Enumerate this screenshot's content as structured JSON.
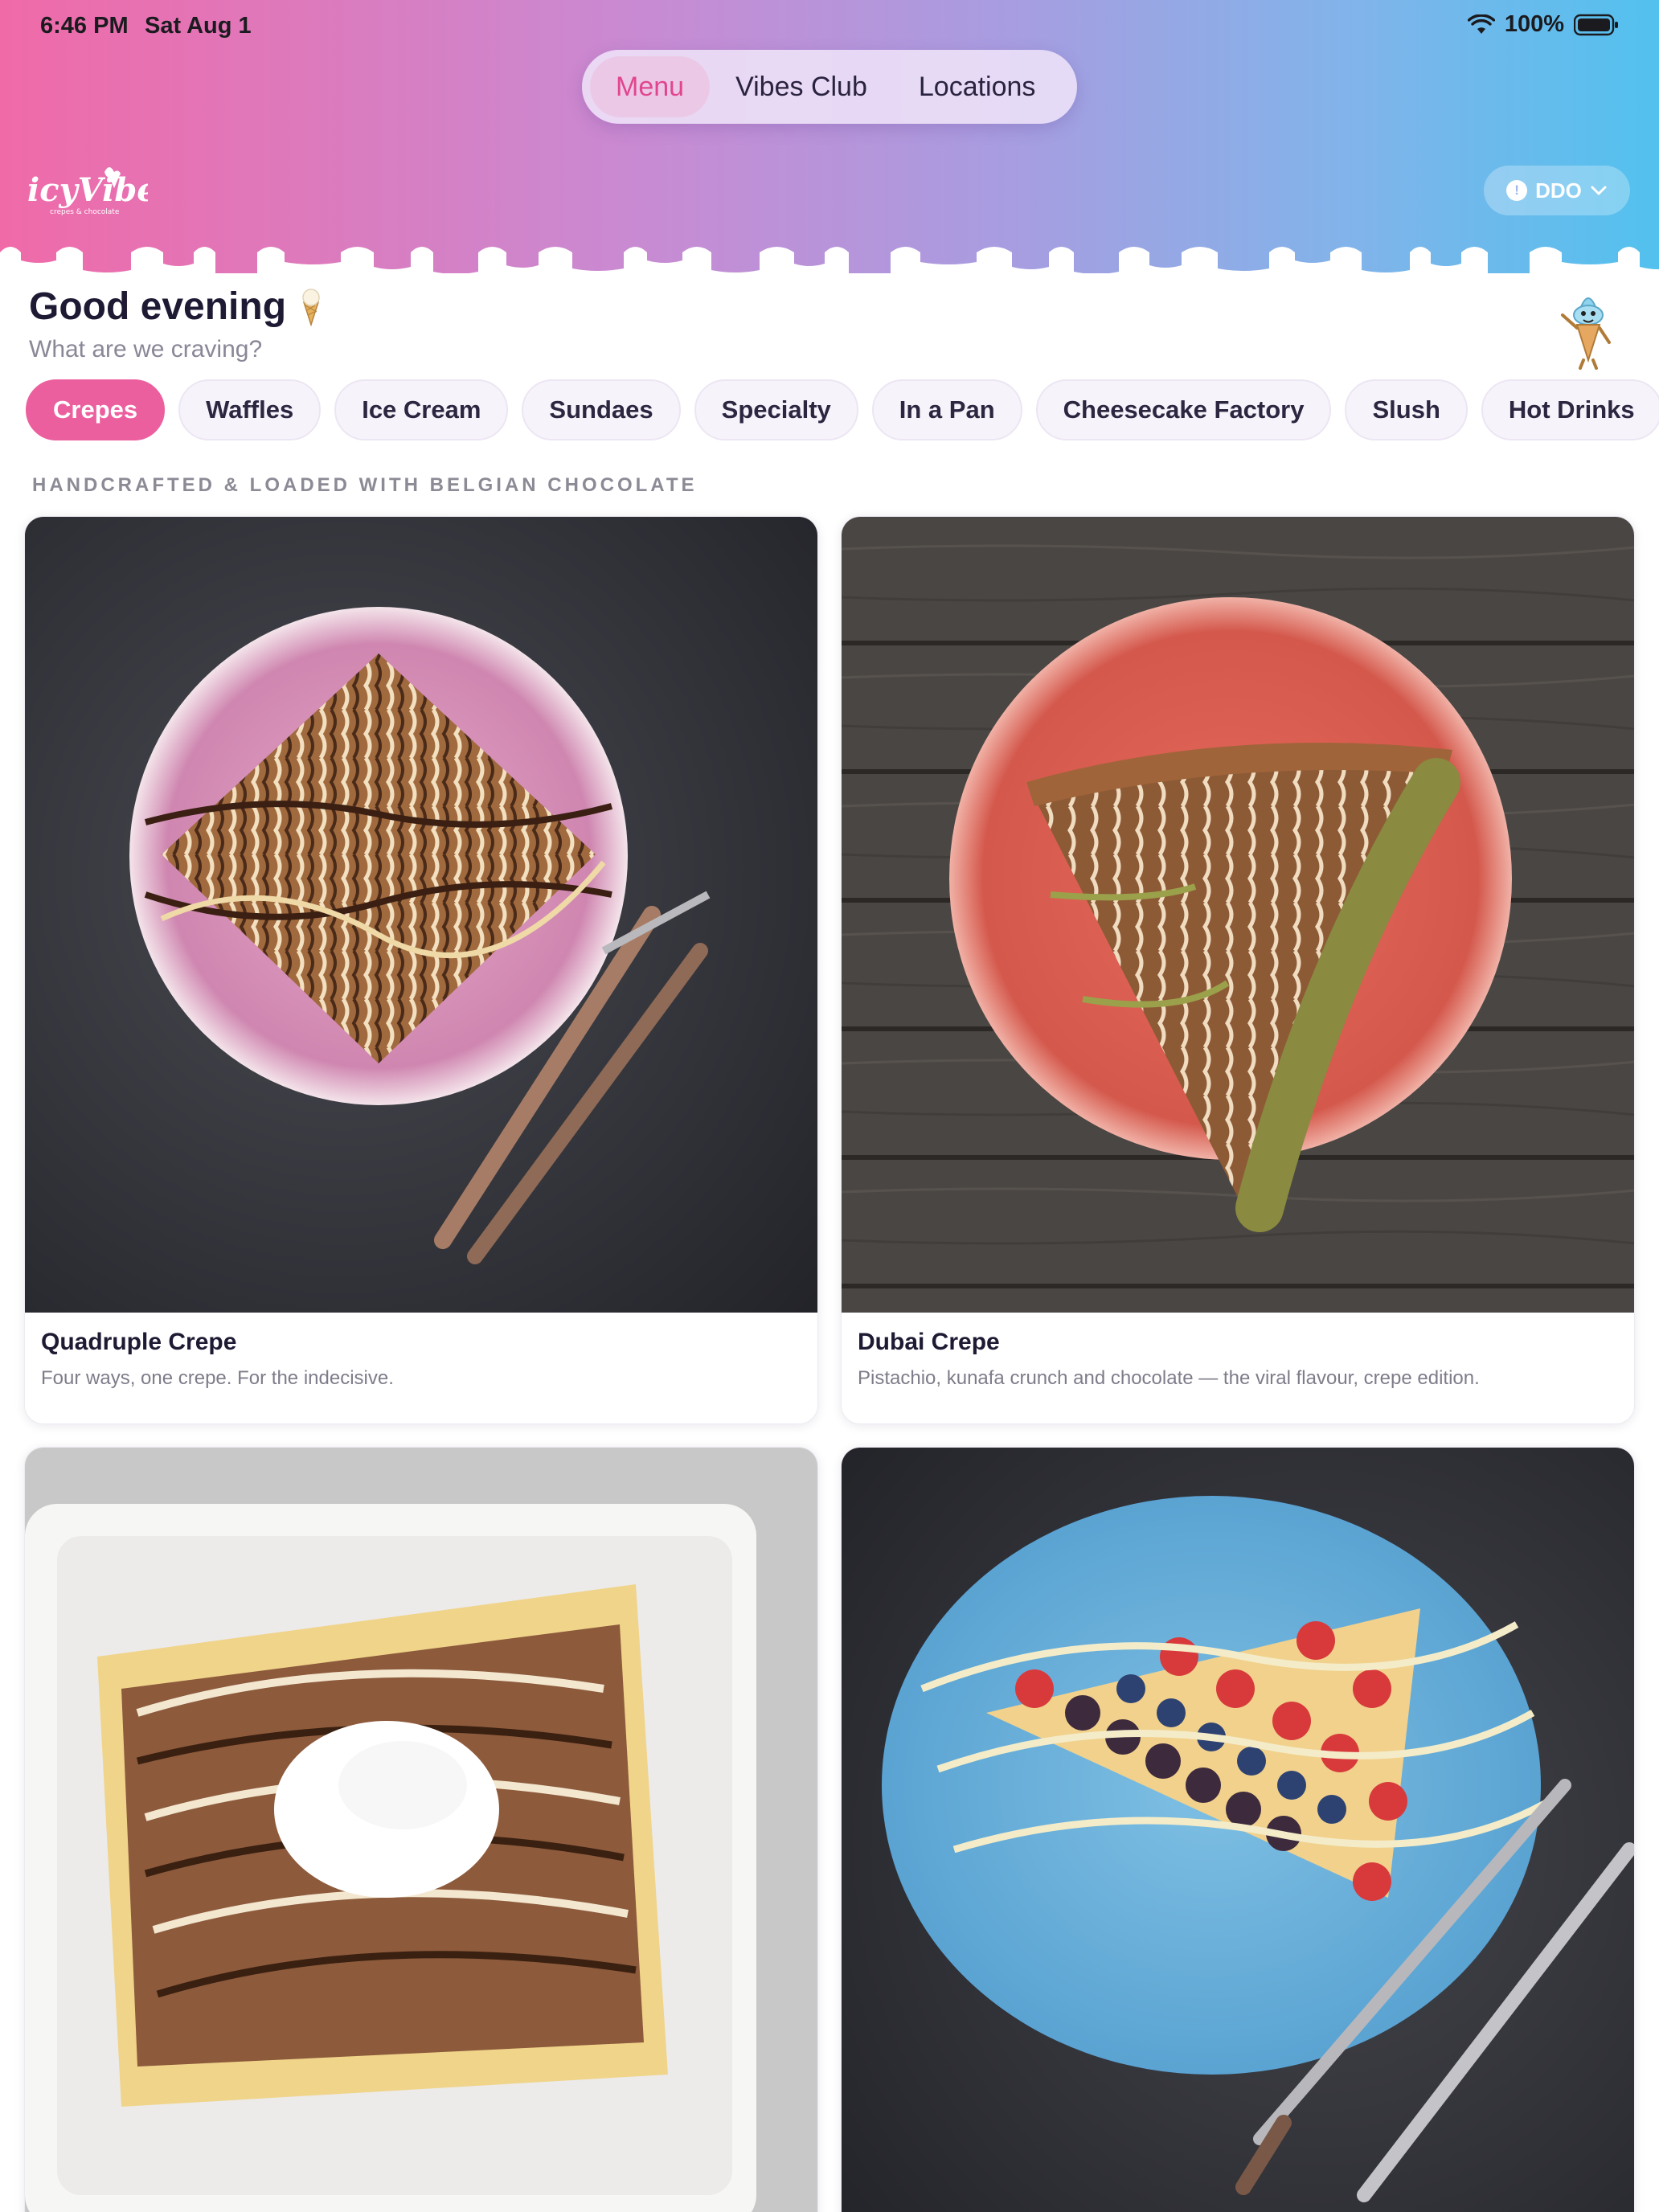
{
  "status": {
    "time": "6:46 PM",
    "date": "Sat Aug 1",
    "battery": "100%"
  },
  "nav": {
    "tabs": [
      "Menu",
      "Vibes Club",
      "Locations"
    ],
    "active": "Menu"
  },
  "brand": {
    "logo_text": "icyVibes",
    "logo_tagline": "crepes & chocolate",
    "accent": "#ec5f9e"
  },
  "store": {
    "label": "DDO"
  },
  "greeting": {
    "title": "Good evening",
    "subtitle": "What are we craving?"
  },
  "categories": [
    "Crepes",
    "Waffles",
    "Ice Cream",
    "Sundaes",
    "Specialty",
    "In a Pan",
    "Cheesecake Factory",
    "Slush",
    "Hot Drinks"
  ],
  "active_category": "Crepes",
  "section": {
    "heading": "HANDCRAFTED & LOADED WITH BELGIAN CHOCOLATE"
  },
  "items": [
    {
      "name": "Quadruple Crepe",
      "description": "Four ways, one crepe. For the indecisive."
    },
    {
      "name": "Dubai Crepe",
      "description": "Pistachio, kunafa crunch and chocolate — the viral flavour, crepe edition."
    }
  ]
}
